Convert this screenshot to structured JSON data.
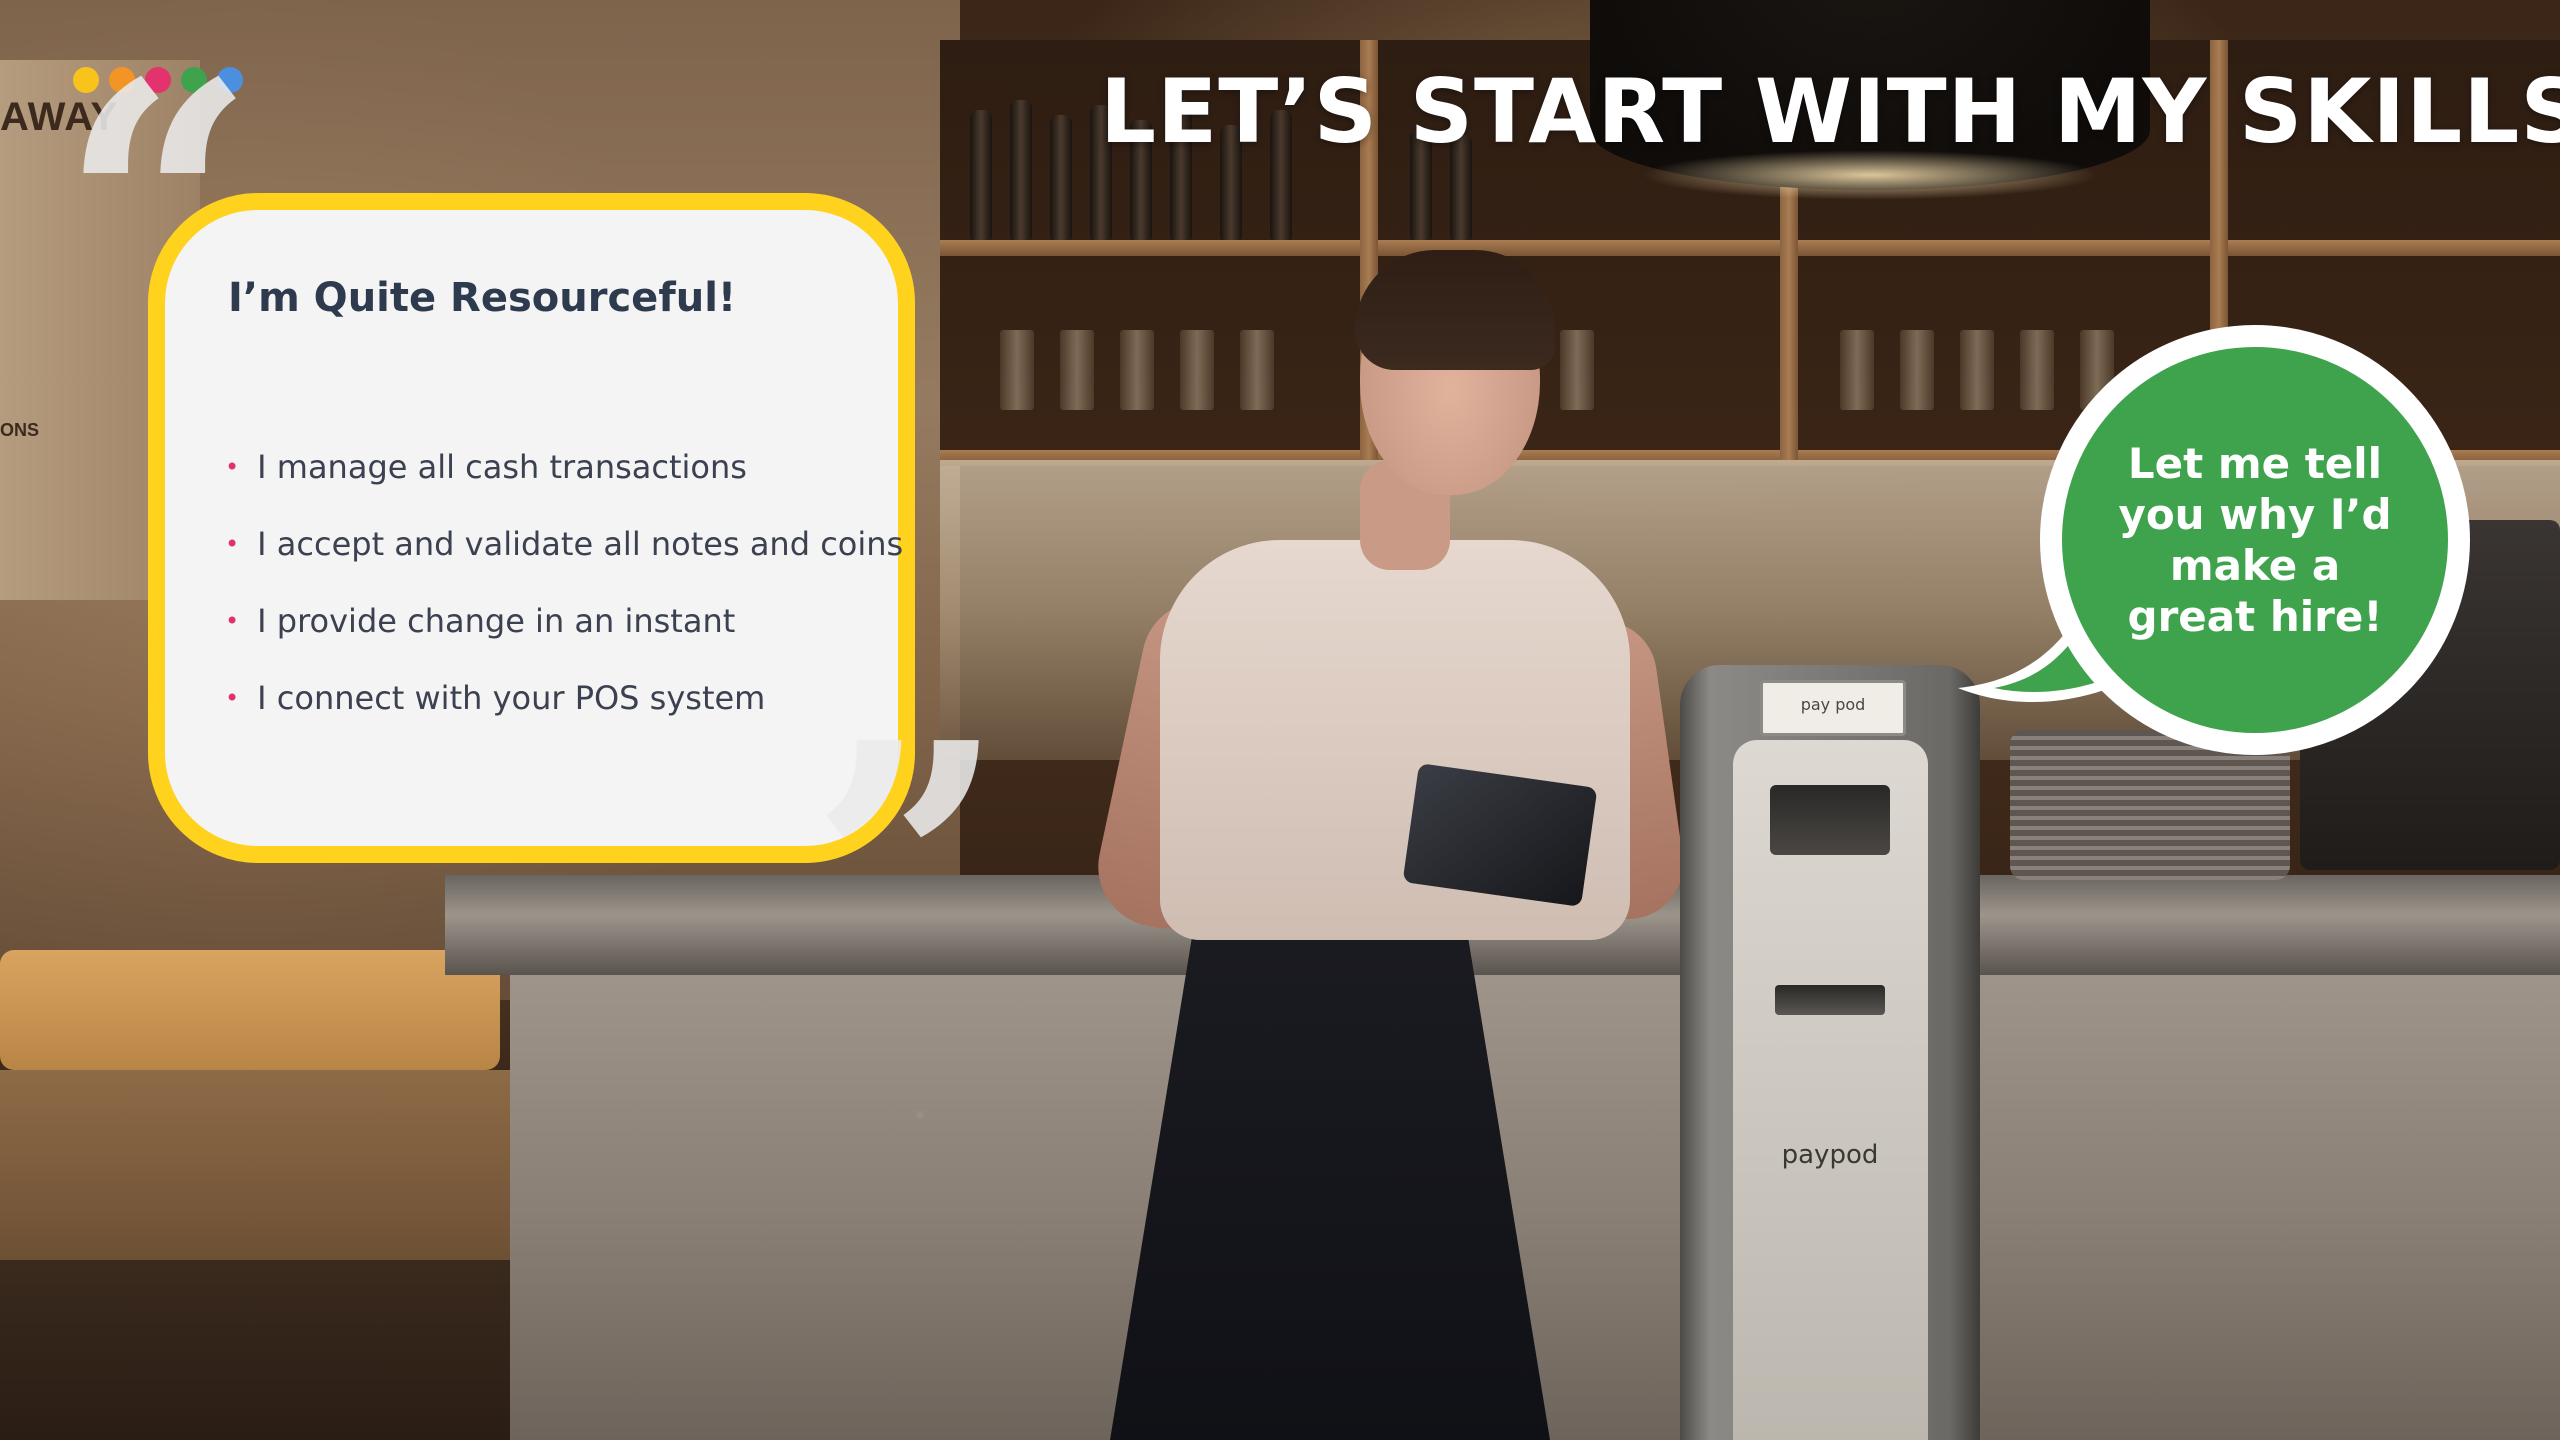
{
  "headline": "LET’S START WITH MY SKILLS",
  "brand_dots": [
    {
      "color": "#f8c31b",
      "name": "dot-yellow"
    },
    {
      "color": "#f39526",
      "name": "dot-orange"
    },
    {
      "color": "#e3336d",
      "name": "dot-pink"
    },
    {
      "color": "#3fa34d",
      "name": "dot-green"
    },
    {
      "color": "#4a8fe0",
      "name": "dot-blue"
    }
  ],
  "skills_card": {
    "title": "I’m Quite Resourceful!",
    "items": [
      "I manage all cash transactions",
      "I accept and validate all notes and coins",
      "I provide change in an instant",
      "I connect with your POS system"
    ],
    "border_color": "#ffd21e",
    "bullet_color": "#e0336b"
  },
  "quote_marks": {
    "open": "“",
    "close": "”"
  },
  "speech_bubble": {
    "text": "Let me tell you why I’d make a great hire!",
    "fill_color": "#3fa34d"
  },
  "background_photo": {
    "wall_sign": "AWAY",
    "wall_sign_2": "ONS",
    "kiosk_brand": "paypod",
    "kiosk_screen": "pay pod"
  }
}
